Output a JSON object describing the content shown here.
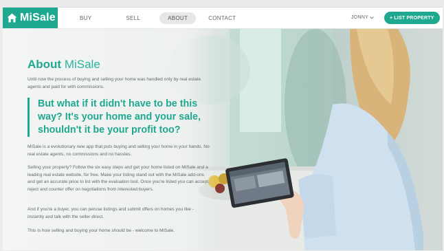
{
  "brand": {
    "name": "MiSale",
    "accent": "#1fa890"
  },
  "nav": {
    "items": [
      {
        "label": "BUY"
      },
      {
        "label": "SELL"
      },
      {
        "label": "ABOUT",
        "active": true
      },
      {
        "label": "CONTACT"
      }
    ],
    "user": "JONNY",
    "list_property": "+ LIST PROPERTY"
  },
  "about": {
    "title_strong": "About",
    "title_light": "MiSale",
    "intro": "Until now the process of buying and selling your home was handled only by real estate agents and paid for with commissions.",
    "quote": "But what if it didn't have to be this way? It's your home and your sale, shouldn't it be your profit too?",
    "p1": "MiSale is a evolutionary new app that puts buying and selling your home in your hands. No real estate agents, no commissions and no hassles.",
    "p2": "Selling your property? Follow the six easy steps and get your home listed on MiSale and a leading real estate website, for free. Make your listing stand out with the MiSale add-ons and get an accurate price to list with the evaluation tool. Once you're listed you can accept, reject and counter offer on negotiations from interested buyers.",
    "p3": "And if you're a buyer, you can peruse listings and submit offers on homes you like - instantly and talk with the seller direct.",
    "p4": "This is how selling and buying your home should be - welcome to MiSale."
  }
}
